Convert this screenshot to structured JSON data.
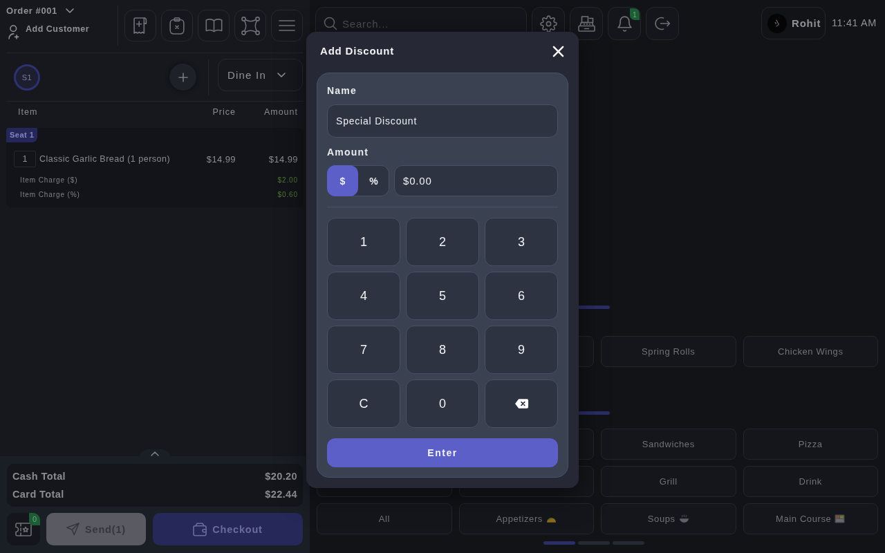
{
  "order_panel": {
    "order_title": "Order #001",
    "add_customer": "Add Customer",
    "seats": [
      {
        "label": "S1",
        "selected": true
      }
    ],
    "order_type": "Dine In",
    "columns": [
      "Item",
      "Price",
      "Amount"
    ],
    "seat_groups": [
      {
        "seat": "Seat 1",
        "items": [
          {
            "quantity": "1",
            "name": "Classic Garlic Bread (1 person)",
            "price": "$14.99",
            "amount": "$14.99",
            "charges": [
              {
                "label": "Item Charge ($)",
                "amount": "$2.00"
              },
              {
                "label": "Item Charge (%)",
                "amount": "$0.60"
              }
            ]
          }
        ]
      }
    ],
    "totals": [
      {
        "label": "Cash Total",
        "value": "$20.20"
      },
      {
        "label": "Card Total",
        "value": "$22.44"
      }
    ],
    "loyalty_badge": "0",
    "actions": [
      {
        "kind": "send",
        "label": "Send(1)"
      },
      {
        "kind": "checkout",
        "label": "Checkout"
      }
    ]
  },
  "top_bar": {
    "search": {
      "placeholder": "Search..."
    },
    "notification_badge": "1",
    "user": "Rohit",
    "time": "11:41 AM"
  },
  "carousels": [
    {
      "pages": [
        {
          "selected": true
        }
      ]
    },
    {
      "rows": [
        [
          {
            "label": "Spring Rolls",
            "kind": "plain"
          },
          {
            "label": "Chicken Wings",
            "kind": "plain"
          }
        ]
      ],
      "pages": [
        {
          "selected": true
        }
      ]
    },
    {
      "rows": [
        [
          {
            "label": "Sandwiches",
            "kind": "plain"
          },
          {
            "label": "Pizza",
            "kind": "plain"
          }
        ],
        [
          {
            "label": "Grill",
            "kind": "plain"
          },
          {
            "label": "Drink",
            "kind": "plain"
          }
        ],
        [
          {
            "label": "All",
            "kind": "plain"
          },
          {
            "label": "Appetizers",
            "kind": "taco"
          },
          {
            "label": "Soups",
            "kind": "soup"
          },
          {
            "label": "Main Course",
            "kind": "bento"
          }
        ]
      ],
      "pages": [
        {
          "selected": true
        },
        {
          "selected": false
        },
        {
          "selected": false
        }
      ]
    }
  ],
  "dialog": {
    "title": "Add Discount",
    "name_field": {
      "label": "Name",
      "value": "Special Discount"
    },
    "amount_field": {
      "label": "Amount",
      "modes": [
        {
          "label": "$",
          "selected": true
        },
        {
          "label": "%",
          "selected": false
        }
      ],
      "value": "$0.00"
    },
    "keypad": [
      {
        "kind": "digit",
        "label": "1"
      },
      {
        "kind": "digit",
        "label": "2"
      },
      {
        "kind": "digit",
        "label": "3"
      },
      {
        "kind": "digit",
        "label": "4"
      },
      {
        "kind": "digit",
        "label": "5"
      },
      {
        "kind": "digit",
        "label": "6"
      },
      {
        "kind": "digit",
        "label": "7"
      },
      {
        "kind": "digit",
        "label": "8"
      },
      {
        "kind": "digit",
        "label": "9"
      },
      {
        "kind": "clear",
        "label": "C"
      },
      {
        "kind": "digit",
        "label": "0"
      },
      {
        "kind": "backspace"
      }
    ],
    "submit": "Enter"
  }
}
